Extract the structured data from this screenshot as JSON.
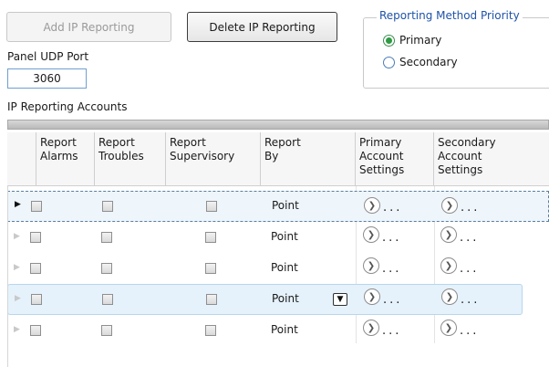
{
  "toolbar": {
    "add_label": "Add IP Reporting",
    "delete_label": "Delete IP Reporting"
  },
  "priority": {
    "title": "Reporting Method Priority",
    "options": [
      {
        "label": "Primary",
        "selected": true
      },
      {
        "label": "Secondary",
        "selected": false
      }
    ]
  },
  "port": {
    "label": "Panel UDP Port",
    "value": "3060"
  },
  "accounts": {
    "label": "IP Reporting Accounts",
    "columns": [
      "Report\nAlarms",
      "Report\nTroubles",
      "Report\nSupervisory",
      "Report\nBy",
      "Primary\nAccount\nSettings",
      "Secondary\nAccount\nSettings"
    ],
    "rows": [
      {
        "report_alarms": false,
        "report_troubles": false,
        "report_supervisory": false,
        "report_by": "Point",
        "primary_settings": "...",
        "secondary_settings": "...",
        "current": true
      },
      {
        "report_alarms": false,
        "report_troubles": false,
        "report_supervisory": false,
        "report_by": "Point",
        "primary_settings": "...",
        "secondary_settings": "..."
      },
      {
        "report_alarms": false,
        "report_troubles": false,
        "report_supervisory": false,
        "report_by": "Point",
        "primary_settings": "...",
        "secondary_settings": "..."
      },
      {
        "report_alarms": false,
        "report_troubles": false,
        "report_supervisory": false,
        "report_by": "Point",
        "primary_settings": "...",
        "secondary_settings": "...",
        "dropdown_visible": true
      },
      {
        "report_alarms": false,
        "report_troubles": false,
        "report_supervisory": false,
        "report_by": "Point",
        "primary_settings": "...",
        "secondary_settings": "..."
      }
    ]
  },
  "icons": {
    "row_indicator": "row-indicator-arrow-icon",
    "expand": "expand-circle-icon",
    "dropdown": "chevron-down-icon"
  },
  "colors": {
    "group_title": "#1f53a8",
    "radio_selected": "#2f9a43",
    "current_row_border": "#5a7fa0",
    "hover_row_background": "#e5f2fb"
  }
}
